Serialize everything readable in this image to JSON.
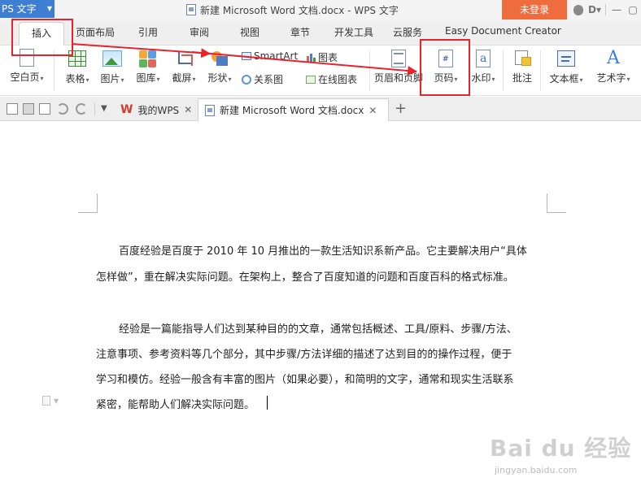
{
  "titlebar": {
    "app_menu": "PS 文字",
    "doc_title": "新建 Microsoft Word 文档.docx - WPS 文字",
    "login": "未登录"
  },
  "tabs": [
    {
      "label": "插入",
      "active": true
    },
    {
      "label": "页面布局"
    },
    {
      "label": "引用"
    },
    {
      "label": "审阅"
    },
    {
      "label": "视图"
    },
    {
      "label": "章节"
    },
    {
      "label": "开发工具"
    },
    {
      "label": "云服务"
    },
    {
      "label": "Easy Document Creator"
    }
  ],
  "ribbon": {
    "blank_page": "空白页",
    "table": "表格",
    "picture": "图片",
    "gallery": "图库",
    "screenshot": "截屏",
    "shape": "形状",
    "smartart": "SmartArt",
    "relation_chart": "关系图",
    "chart": "图表",
    "online_chart": "在线图表",
    "header_footer": "页眉和页脚",
    "page_number": "页码",
    "watermark": "水印",
    "comment": "批注",
    "textbox": "文本框",
    "art_text": "艺术字"
  },
  "doc_tabs": [
    {
      "label": "我的WPS",
      "logo": "W"
    },
    {
      "label": "新建 Microsoft Word 文档.docx",
      "active": true
    }
  ],
  "document": {
    "para1": [
      "百度经验是百度于 2010 年 10 月推出的一款生活知识系新产品。它主要解决用户“具体",
      "怎样做”，重在解决实际问题。在架构上，整合了百度知道的问题和百度百科的格式标准。"
    ],
    "para2": [
      "经验是一篇能指导人们达到某种目的的文章，通常包括概述、工具/原料、步骤/方法、",
      "注意事项、参考资料等几个部分，其中步骤/方法详细的描述了达到目的的操作过程，便于",
      "学习和模仿。经验一般含有丰富的图片（如果必要），和简明的文字，通常和现实生活联系",
      "紧密，能帮助人们解决实际问题。"
    ]
  },
  "watermark": {
    "brand": "Bai du 经验",
    "url": "jingyan.baidu.com"
  },
  "colors": {
    "annotation_red": "#e8232b",
    "wps_blue": "#3f7fd3",
    "login_orange": "#ef6c3f"
  },
  "icons": [
    "doc-icon",
    "shield-icon",
    "close-icon",
    "plus-icon",
    "undo-icon",
    "redo-icon",
    "print-icon",
    "save-icon"
  ]
}
